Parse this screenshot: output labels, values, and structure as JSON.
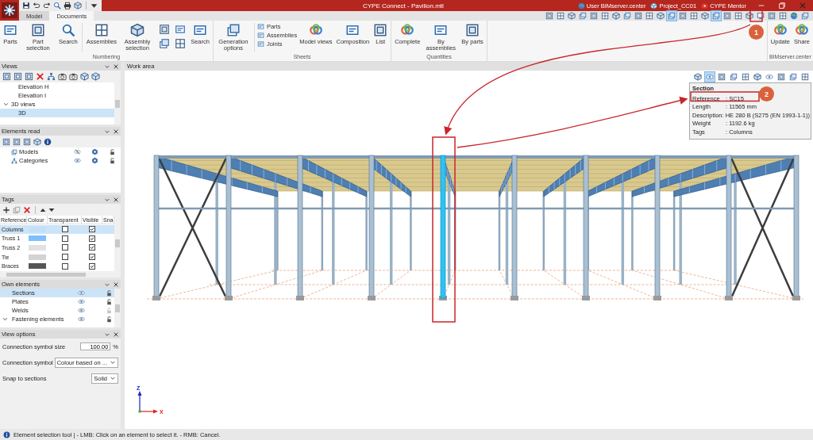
{
  "window": {
    "title": "CYPE Connect - Pavilion.mtl",
    "links": [
      {
        "label": "User BIMserver.center"
      },
      {
        "label": "Project_CC01"
      },
      {
        "label": "CYPE Mentor"
      }
    ]
  },
  "tabs": [
    {
      "label": "Model",
      "selected": false
    },
    {
      "label": "Documents",
      "selected": true
    }
  ],
  "view_toolbar": [
    {
      "selected": false
    },
    {
      "selected": false
    },
    {
      "selected": false
    },
    {
      "selected": false
    },
    {
      "selected": false
    },
    {
      "selected": false
    },
    {
      "selected": false
    },
    {
      "selected": false
    },
    {
      "selected": false
    },
    {
      "selected": false
    },
    {
      "selected": false
    },
    {
      "selected": true
    },
    {
      "selected": false
    },
    {
      "selected": false
    },
    {
      "selected": false
    },
    {
      "selected": true
    },
    {
      "selected": false
    },
    {
      "selected": false
    },
    {
      "selected": false
    },
    {
      "selected": false
    },
    {
      "selected": false
    },
    {
      "selected": false
    },
    {
      "selected": false
    },
    {
      "selected": false
    }
  ],
  "ribbon_groups": [
    {
      "label": "Numbering",
      "items": [
        {
          "kind": "large",
          "label": "Parts"
        },
        {
          "kind": "large",
          "label": "Part selection"
        },
        {
          "kind": "large",
          "label": "Search"
        },
        {
          "kind": "separator"
        },
        {
          "kind": "large",
          "label": "Assemblies"
        },
        {
          "kind": "large",
          "label": "Assembly selection"
        },
        {
          "kind": "icon-grid"
        },
        {
          "kind": "large",
          "label": "Search"
        }
      ]
    },
    {
      "label": "Sheets",
      "items": [
        {
          "kind": "large",
          "label": "Generation options"
        },
        {
          "kind": "separator"
        },
        {
          "kind": "small-stack",
          "labels": [
            "Parts",
            "Assemblies",
            "Joints"
          ]
        },
        {
          "kind": "large",
          "label": "Model views"
        },
        {
          "kind": "large",
          "label": "Composition"
        },
        {
          "kind": "large",
          "label": "List"
        }
      ]
    },
    {
      "label": "Quantities",
      "items": [
        {
          "kind": "large",
          "label": "Complete"
        },
        {
          "kind": "large",
          "label": "By assemblies"
        },
        {
          "kind": "large",
          "label": "By parts"
        }
      ]
    },
    {
      "label": "BIMserver.center",
      "items": [
        {
          "kind": "large",
          "label": "Update"
        },
        {
          "kind": "large",
          "label": "Share"
        }
      ]
    }
  ],
  "views_panel": {
    "title": "Views",
    "tree": [
      {
        "label": "Elevation H",
        "selected": false
      },
      {
        "label": "Elevation I",
        "selected": false
      },
      {
        "label": "3D views",
        "selected": false,
        "expanded": true,
        "children": [
          {
            "label": "3D",
            "selected": true
          }
        ]
      }
    ]
  },
  "elements_read_panel": {
    "title": "Elements read",
    "tree": [
      {
        "label": "Models",
        "visible": false
      },
      {
        "label": "Categories",
        "visible": true
      }
    ]
  },
  "tags_panel": {
    "title": "Tags",
    "columns": [
      "Reference",
      "Colour",
      "Transparent",
      "Visible",
      "Sna"
    ],
    "rows": [
      {
        "reference": "Columns",
        "color": "#c4e0f9",
        "transparent": false,
        "visible": true,
        "selected": true
      },
      {
        "reference": "Truss 1",
        "color": "#80bfff",
        "transparent": false,
        "visible": true,
        "selected": false
      },
      {
        "reference": "Truss 2",
        "color": "#e2e2e2",
        "transparent": false,
        "visible": true,
        "selected": false
      },
      {
        "reference": "Tie",
        "color": "#d3d3d3",
        "transparent": false,
        "visible": true,
        "selected": false
      },
      {
        "reference": "Braces",
        "color": "#555555",
        "transparent": false,
        "visible": true,
        "selected": false
      }
    ]
  },
  "own_elements_panel": {
    "title": "Own elements",
    "tree": [
      {
        "label": "Sections",
        "selected": true,
        "lock_disabled": false
      },
      {
        "label": "Plates",
        "selected": false,
        "lock_disabled": false
      },
      {
        "label": "Welds",
        "selected": false,
        "lock_disabled": true
      },
      {
        "label": "Fastening elements",
        "selected": false,
        "lock_disabled": false,
        "expanded": true
      }
    ]
  },
  "view_options_panel": {
    "title": "View options",
    "fields": [
      {
        "kind": "number",
        "label": "Connection symbol size",
        "value": "100.00",
        "unit": "%"
      },
      {
        "kind": "select",
        "label": "Connection symbol",
        "value": "Colour based on ..."
      },
      {
        "kind": "select",
        "label": "Snap to sections",
        "value": "Solid"
      }
    ]
  },
  "work_area": {
    "title": "Work area",
    "toolbar": [
      {
        "selected": false
      },
      {
        "selected": true
      },
      {
        "selected": false
      },
      {
        "selected": false
      },
      {
        "selected": false
      },
      {
        "selected": false
      },
      {
        "selected": false
      },
      {
        "selected": false
      },
      {
        "selected": false
      },
      {
        "selected": false
      }
    ],
    "info_panel": {
      "title": "Section",
      "rows": [
        {
          "label": "Reference",
          "value": ": SC15"
        },
        {
          "label": "Length",
          "value": ": 11565 mm"
        },
        {
          "label": "Description",
          "value": ": HE 280 B (S275 (EN 1993-1-1))"
        },
        {
          "label": "Weight",
          "value": ": 1192.6 kg"
        },
        {
          "label": "Tags",
          "value": ": Columns"
        }
      ]
    },
    "axes": {
      "z": "Z",
      "x": "X"
    }
  },
  "annotations": [
    {
      "label": "1"
    },
    {
      "label": "2"
    }
  ],
  "status_bar": {
    "text": "Element selection tool | - LMB: Click on an element to select it. - RMB: Cancel."
  }
}
